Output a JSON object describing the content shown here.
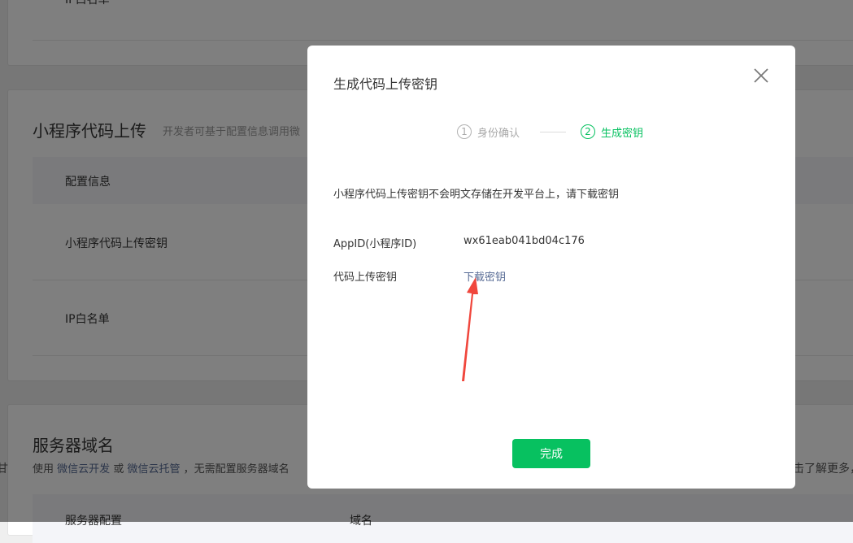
{
  "background": {
    "top_card": {
      "row_label": "IP白名单"
    },
    "upload_section": {
      "title": "小程序代码上传",
      "description": "开发者可基于配置信息调用微",
      "table_header": "配置信息",
      "rows": [
        "小程序代码上传密钥",
        "IP白名单"
      ]
    },
    "server_domain_section": {
      "title": "服务器域名",
      "desc_prefix": "使用",
      "link1": "微信云开发",
      "desc_or": "或",
      "link2": "微信云托管",
      "desc_suffix": "，无需配置服务器域名",
      "right_fragment": "击了解更多，",
      "left_fragment": "甘",
      "table_headers": [
        "服务器配置",
        "域名"
      ]
    }
  },
  "dialog": {
    "title": "生成代码上传密钥",
    "close_icon": "close-icon",
    "steps": [
      {
        "number": "1",
        "label": "身份确认",
        "state": "done"
      },
      {
        "number": "2",
        "label": "生成密钥",
        "state": "active"
      }
    ],
    "notice": "小程序代码上传密钥不会明文存储在开发平台上，请下载密钥",
    "fields": [
      {
        "label": "AppID(小程序ID)",
        "value": "wx61eab041bd04c176"
      },
      {
        "label": "代码上传密钥",
        "value": "下载密钥"
      }
    ],
    "done_button": "完成"
  },
  "colors": {
    "accent": "#07c160",
    "link": "#576b95",
    "overlay": "rgba(0,0,0,0.5)",
    "annotation_arrow": "#f0463c"
  }
}
